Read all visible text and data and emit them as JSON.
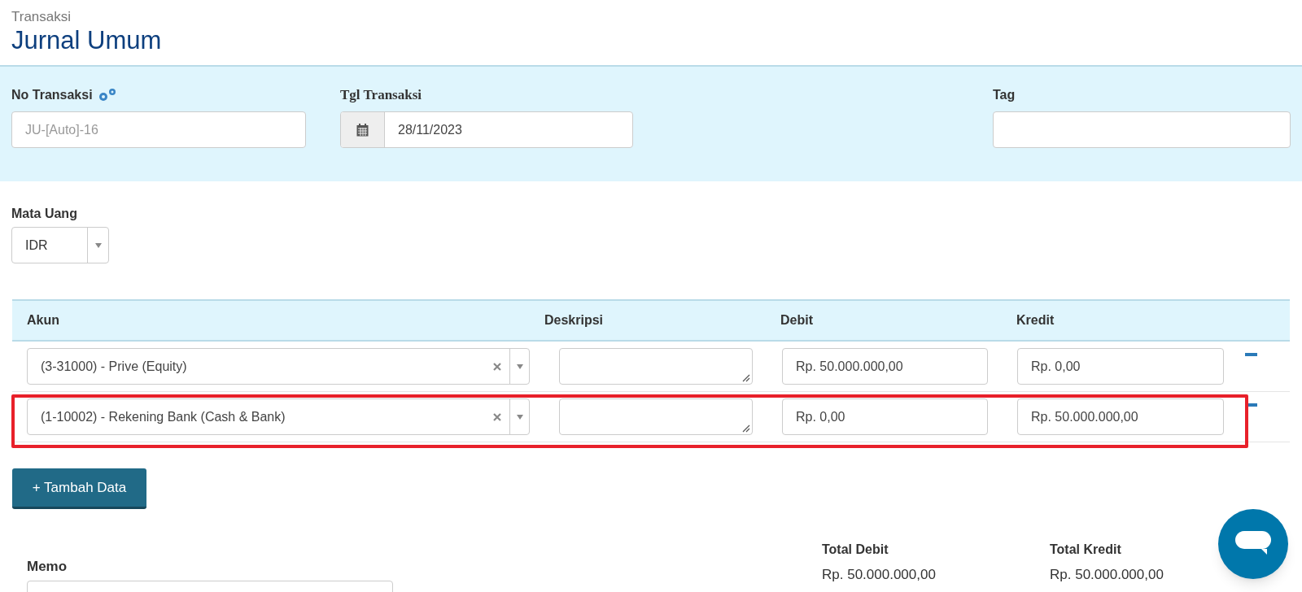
{
  "header": {
    "breadcrumb": "Transaksi",
    "title": "Jurnal Umum"
  },
  "fields": [
    {
      "label": "No Transaksi",
      "placeholder": "JU-[Auto]-16"
    },
    {
      "label": "Tgl Transaksi",
      "value": "28/11/2023"
    },
    {
      "label": "Tag"
    }
  ],
  "currency": {
    "label": "Mata Uang",
    "value": "IDR"
  },
  "table": {
    "columns": [
      "Akun",
      "Deskripsi",
      "Debit",
      "Kredit"
    ],
    "rows": [
      {
        "account": "(3-31000) - Prive (Equity)",
        "debit": "Rp. 50.000.000,00",
        "credit": "Rp. 0,00",
        "highlighted": false
      },
      {
        "account": "(1-10002) - Rekening Bank (Cash & Bank)",
        "debit": "Rp. 0,00",
        "credit": "Rp. 50.000.000,00",
        "highlighted": true
      }
    ]
  },
  "add_button": "+ Tambah Data",
  "memo": {
    "label": "Memo"
  },
  "totals": [
    {
      "label": "Total Debit",
      "value": "Rp. 50.000.000,00"
    },
    {
      "label": "Total Kredit",
      "value": "Rp. 50.000.000,00"
    }
  ]
}
